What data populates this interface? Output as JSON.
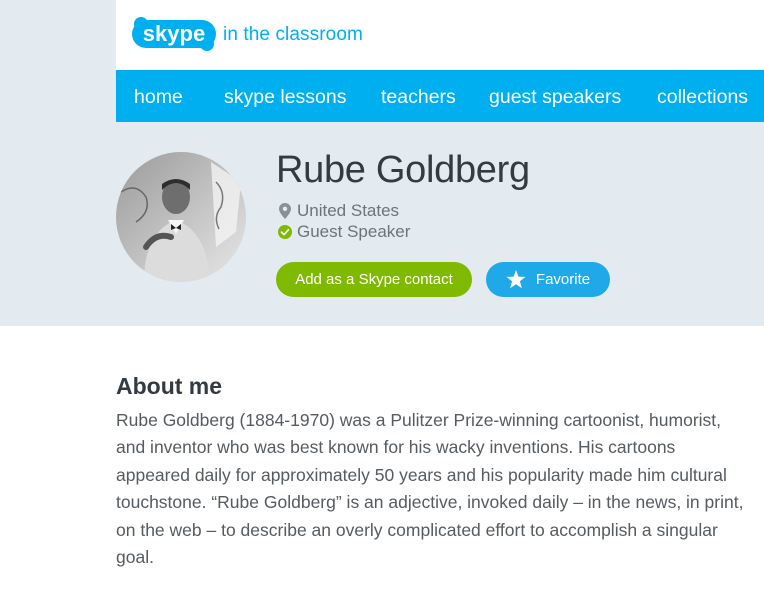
{
  "brand": {
    "logo_word": "skype",
    "tagline": "in the classroom",
    "color": "#00aff0"
  },
  "nav": {
    "items": [
      {
        "label": "home"
      },
      {
        "label": "skype lessons"
      },
      {
        "label": "teachers"
      },
      {
        "label": "guest speakers"
      },
      {
        "label": "collections"
      }
    ]
  },
  "profile": {
    "name": "Rube Goldberg",
    "location": "United States",
    "role": "Guest Speaker",
    "add_contact_label": "Add as a Skype contact",
    "favorite_label": "Favorite",
    "colors": {
      "add_button": "#7fba00",
      "favorite_button": "#1fa9e8",
      "verified": "#7fba00"
    }
  },
  "about": {
    "title": "About me",
    "text": "Rube Goldberg (1884-1970) was a Pulitzer Prize-winning cartoonist, humorist, and inventor who was best known for his wacky inventions. His cartoons appeared daily for approximately 50 years and his popularity made him cultural touchstone. “Rube Goldberg” is an adjective, invoked daily – in the news, in print, on the web – to describe an overly complicated effort to accomplish a singular goal."
  },
  "icons": {
    "location": "map-pin-icon",
    "verified": "check-circle-icon",
    "favorite": "star-icon"
  }
}
